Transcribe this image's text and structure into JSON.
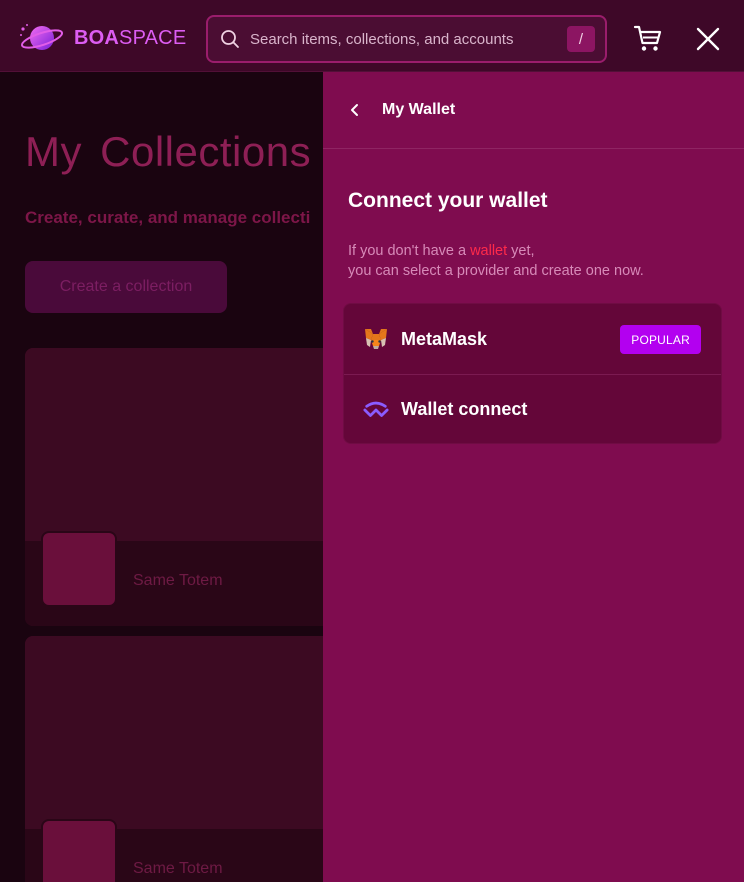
{
  "header": {
    "logo_bold": "BOA",
    "logo_light": "SPACE",
    "search_placeholder": "Search items, collections, and accounts",
    "search_shortcut": "/",
    "icons": {
      "search": "search-icon",
      "cart": "cart-icon",
      "close": "close-icon"
    }
  },
  "background_page": {
    "title": "My Collections",
    "subtitle": "Create, curate, and manage collecti",
    "create_button": "Create a collection",
    "cards": [
      {
        "name": "Same Totem"
      },
      {
        "name": "Same Totem"
      }
    ]
  },
  "wallet_panel": {
    "title": "My Wallet",
    "heading": "Connect your wallet",
    "description_prefix": "If you don't have a ",
    "description_highlight": "wallet",
    "description_suffix": " yet,",
    "description_line2": "you can select a provider and create one now.",
    "wallets": [
      {
        "name": "MetaMask",
        "icon": "metamask-fox-icon",
        "badge": "POPULAR"
      },
      {
        "name": "Wallet connect",
        "icon": "walletconnect-icon"
      }
    ]
  },
  "colors": {
    "header_bg": "#3e0828",
    "panel_bg": "#7f0c4f",
    "accent_purple": "#b300f0",
    "logo_pink": "#dc5df2",
    "highlight_red": "#ff2a4a"
  }
}
